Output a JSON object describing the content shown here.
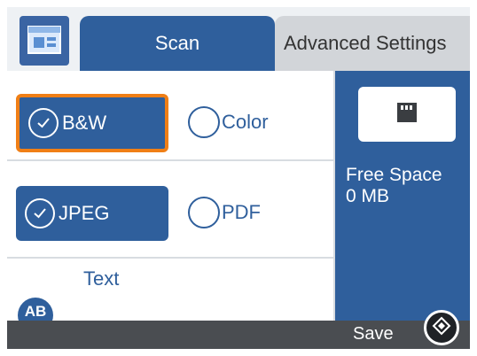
{
  "tabs": [
    {
      "label": "Scan",
      "active": true
    },
    {
      "label": "Advanced Settings",
      "active": false
    }
  ],
  "color_mode": {
    "selected_label": "B&W",
    "other_label": "Color"
  },
  "file_format": {
    "selected_label": "JPEG",
    "other_label": "PDF"
  },
  "text_option": {
    "label": "Text",
    "icon_text": "AB"
  },
  "memory": {
    "free_space_label": "Free Space",
    "free_space_value": "0 MB",
    "icon": "memory-card-icon"
  },
  "footer": {
    "save_label": "Save",
    "start_icon": "start-diamond-icon"
  },
  "colors": {
    "primary": "#2f5f9c",
    "highlight": "#f07f16",
    "footer": "#4a4d51"
  }
}
